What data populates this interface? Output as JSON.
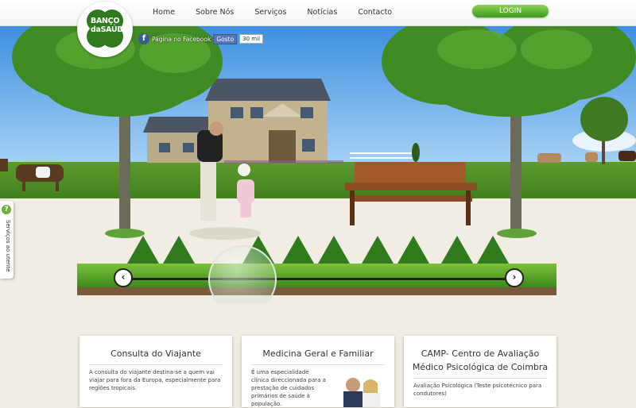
{
  "logo": {
    "line1": "BANÇO",
    "line2": "daSAÚDE"
  },
  "nav": {
    "items": [
      "Home",
      "Sobre Nós",
      "Serviços",
      "Notícias",
      "Contacto"
    ]
  },
  "login_label": "LOGIN",
  "facebook": {
    "icon": "f",
    "page_label": "Página no Facebook",
    "like_label": "Gosto",
    "like_count": "30 mil"
  },
  "side_tab": {
    "icon": "?",
    "label": "Serviços ao utente"
  },
  "slider": {
    "prev": "‹",
    "next": "›"
  },
  "cards": {
    "traveler": {
      "title": "Consulta do Viajante",
      "text1": "A consulta do viajante destina-se a quem vai viajar para fora da Europa, especialmente para regiões tropicais."
    },
    "general": {
      "title": "Medicina Geral e Familiar",
      "text1": "É uma especialidade clínica direccionada para a prestação de cuidados primários de saúde à população."
    },
    "camp": {
      "title1": "CAMP- Centro de Avaliação",
      "title2": "Médico Psicológica de Coimbra",
      "text1": "Avaliação Psicológica (Teste psicotécnico para condutores)"
    }
  },
  "colors": {
    "brand_green": "#2f7a1f",
    "login_green": "#5cb82a",
    "sky": "#4a9be0"
  }
}
